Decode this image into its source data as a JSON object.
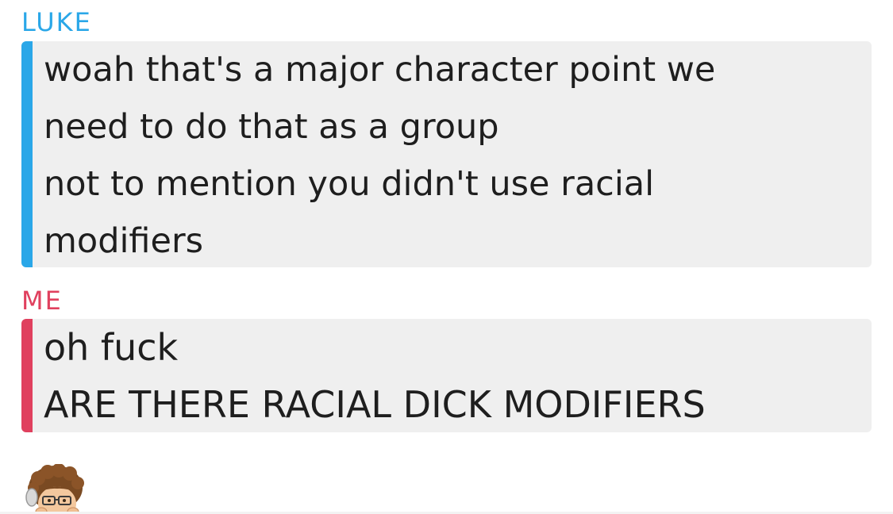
{
  "messages": [
    {
      "sender": "LUKE",
      "color": "#2aa7e8",
      "lines": [
        "woah that's a major character point we",
        "need to do that as a group",
        "not to mention you didn't use racial",
        "modifiers"
      ]
    },
    {
      "sender": "ME",
      "color": "#e0405e",
      "lines": [
        "oh fuck",
        "ARE THERE RACIAL DICK MODIFIERS"
      ]
    }
  ],
  "avatar": {
    "icon": "bitmoji-avatar-icon"
  }
}
